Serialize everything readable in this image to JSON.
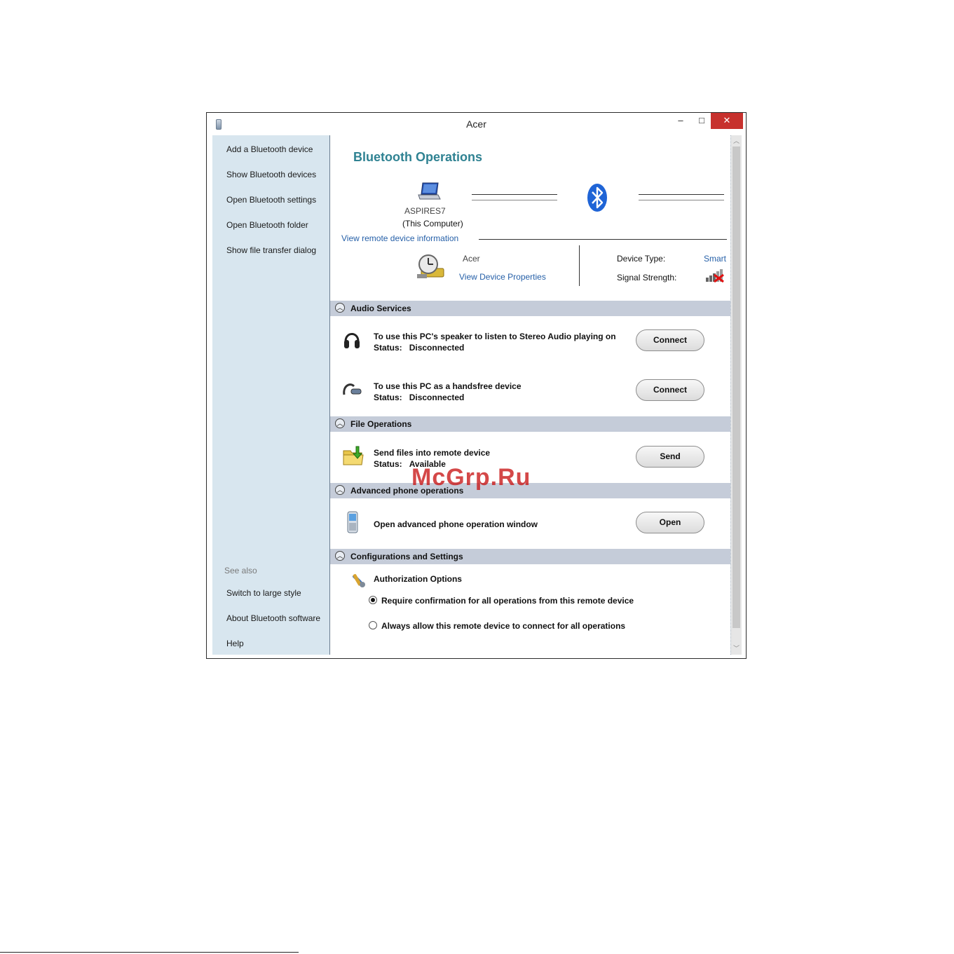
{
  "window": {
    "title": "Acer",
    "controls": {
      "minimize": "–",
      "maximize": "□",
      "close": "✕"
    }
  },
  "sidebar": {
    "items": [
      {
        "label": "Add a Bluetooth device"
      },
      {
        "label": "Show Bluetooth devices"
      },
      {
        "label": "Open Bluetooth settings"
      },
      {
        "label": "Open Bluetooth folder"
      },
      {
        "label": "Show file transfer dialog"
      }
    ],
    "see_also_label": "See also",
    "see_also": [
      {
        "label": "Switch to large style"
      },
      {
        "label": "About Bluetooth software"
      },
      {
        "label": "Help"
      }
    ]
  },
  "main": {
    "heading": "Bluetooth Operations",
    "computer": {
      "name": "ASPIRES7",
      "note": "(This Computer)"
    },
    "view_remote_link": "View remote device information",
    "remote": {
      "name": "Acer",
      "properties_link": "View Device Properties",
      "device_type_label": "Device Type:",
      "device_type_value": "Smart",
      "signal_label": "Signal Strength:"
    },
    "sections": {
      "audio": {
        "title": "Audio Services",
        "rows": [
          {
            "text": "To use this PC's speaker to listen to Stereo Audio playing on",
            "status_label": "Status:",
            "status": "Disconnected",
            "button": "Connect"
          },
          {
            "text": "To use this PC as a handsfree device",
            "status_label": "Status:",
            "status": "Disconnected",
            "button": "Connect"
          }
        ]
      },
      "file": {
        "title": "File Operations",
        "rows": [
          {
            "text": "Send files into remote device",
            "status_label": "Status:",
            "status": "Available",
            "button": "Send"
          }
        ]
      },
      "phone": {
        "title": "Advanced phone operations",
        "rows": [
          {
            "text": "Open advanced phone operation window",
            "button": "Open"
          }
        ]
      },
      "config": {
        "title": "Configurations and Settings",
        "auth_title": "Authorization Options",
        "options": [
          {
            "label": "Require confirmation for all operations from this remote device",
            "selected": true
          },
          {
            "label": "Always allow this remote device to connect for all operations",
            "selected": false
          }
        ]
      }
    }
  },
  "watermark": "McGrp.Ru",
  "colors": {
    "sidebar_bg": "#d8e6ef",
    "heading": "#2f8292",
    "link": "#2660a8",
    "section_bar": "#c5ccd9",
    "close_red": "#c7312d"
  }
}
